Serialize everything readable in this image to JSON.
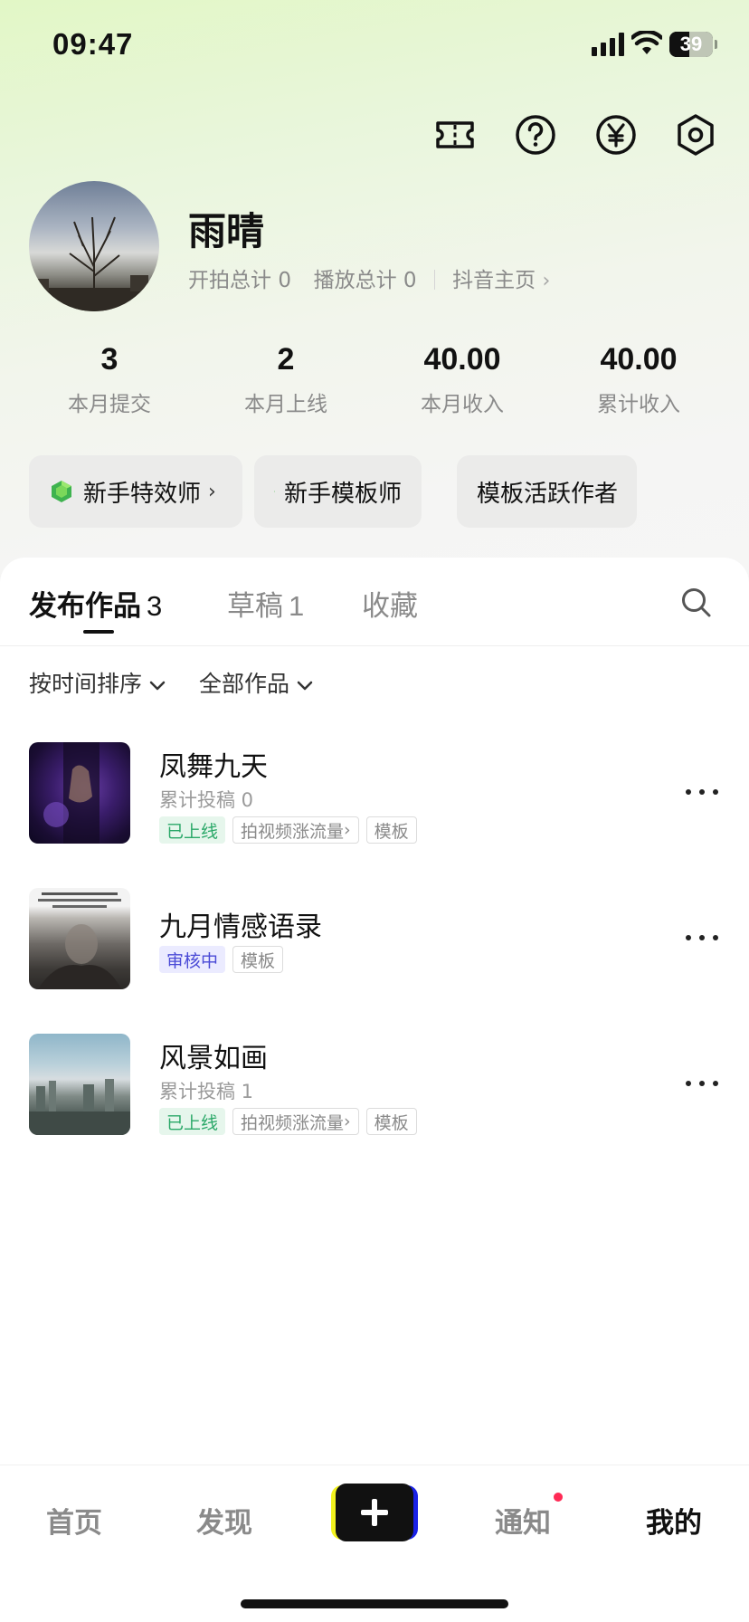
{
  "status_bar": {
    "time": "09:47",
    "battery": "39"
  },
  "top_icons": [
    "ticket-icon",
    "help-icon",
    "yen-icon",
    "settings-icon"
  ],
  "profile": {
    "name": "雨晴",
    "shoot_total_label": "开拍总计",
    "shoot_total": "0",
    "play_total_label": "播放总计",
    "play_total": "0",
    "douyin_link": "抖音主页"
  },
  "metrics": [
    {
      "value": "3",
      "label": "本月提交"
    },
    {
      "value": "2",
      "label": "本月上线"
    },
    {
      "value": "40.00",
      "label": "本月收入"
    },
    {
      "value": "40.00",
      "label": "累计收入"
    }
  ],
  "badges": [
    {
      "label": "新手特效师",
      "arrow": "›"
    },
    {
      "label": "新手模板师"
    },
    {
      "label": "模板活跃作者"
    }
  ],
  "tabs": [
    {
      "label": "发布作品",
      "count": "3"
    },
    {
      "label": "草稿",
      "count": "1"
    },
    {
      "label": "收藏",
      "count": ""
    }
  ],
  "filters": {
    "sort": "按时间排序",
    "category": "全部作品"
  },
  "works": [
    {
      "title": "凤舞九天",
      "sub": "累计投稿 0",
      "tags": [
        "已上线",
        "拍视频涨流量",
        "模板"
      ]
    },
    {
      "title": "九月情感语录",
      "sub": "",
      "tags": [
        "审核中",
        "模板"
      ]
    },
    {
      "title": "风景如画",
      "sub": "累计投稿 1",
      "tags": [
        "已上线",
        "拍视频涨流量",
        "模板"
      ]
    }
  ],
  "bottom_nav": {
    "home": "首页",
    "discover": "发现",
    "notify": "通知",
    "mine": "我的"
  },
  "colors": {
    "online_green": "#2aa868",
    "review_blue": "#4a4ad6",
    "notif_red": "#ff2a55",
    "bg_green": "#e2f7c6"
  }
}
